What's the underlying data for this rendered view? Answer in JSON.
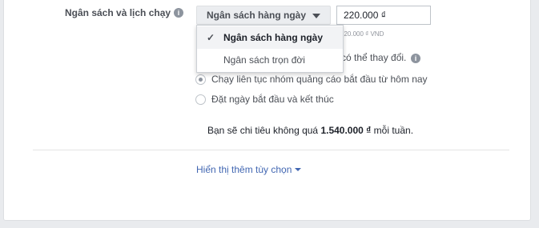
{
  "budget": {
    "label": "Ngân sách và lịch chạy",
    "info_icon": "info-icon",
    "type_select": "Ngân sách hàng ngày",
    "amount_value": "220.000 ₫",
    "amount_hint": "220.000 ₫ VND",
    "dropdown_options": [
      {
        "label": "Ngân sách hàng ngày",
        "selected": true
      },
      {
        "label": "Ngân sách trọn đời",
        "selected": false
      }
    ]
  },
  "schedule": {
    "partial_text": "có thể thay đổi.",
    "options": [
      {
        "label": "Chạy liên tục nhóm quảng cáo bắt đầu từ hôm nay",
        "checked": true
      },
      {
        "label": "Đặt ngày bắt đầu và kết thúc",
        "checked": false
      }
    ]
  },
  "summary": {
    "prefix": "Bạn sẽ chi tiêu không quá ",
    "amount": "1.540.000 ₫",
    "suffix": " mỗi tuần."
  },
  "more_options": {
    "label": "Hiển thị thêm tùy chọn"
  },
  "colors": {
    "link": "#4267b2",
    "background": "#e9ebee"
  }
}
